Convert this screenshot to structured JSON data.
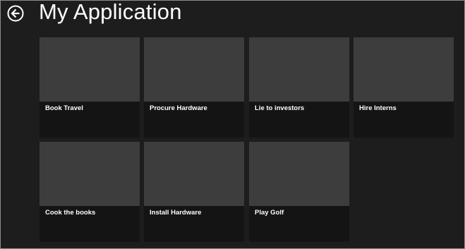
{
  "header": {
    "title": "My Application",
    "back_icon": "back-arrow-circle-icon"
  },
  "tiles": [
    {
      "label": "Book Travel"
    },
    {
      "label": "Procure Hardware"
    },
    {
      "label": "Lie to investors"
    },
    {
      "label": "Hire Interns"
    },
    {
      "label": "Cook the books"
    },
    {
      "label": "Install Hardware"
    },
    {
      "label": "Play Golf"
    }
  ],
  "colors": {
    "background": "#1d1d1d",
    "tile_image": "#3d3d3d",
    "tile_body": "#141414",
    "text": "#ffffff"
  }
}
